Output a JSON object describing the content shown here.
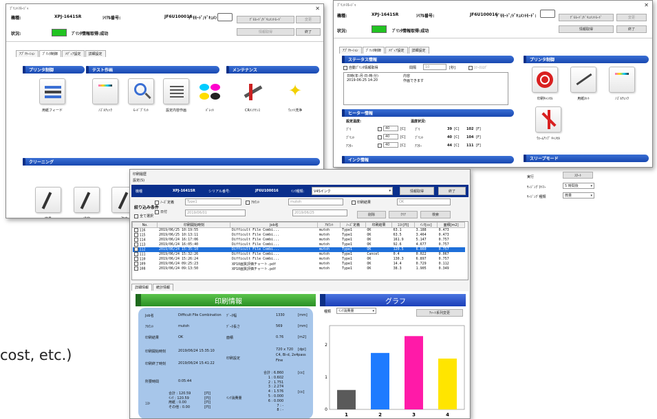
{
  "left_window": {
    "title": "ﾌﾟﾘﾝﾄﾏﾈｰｼﾞｬ",
    "model_label": "機種:",
    "model": "XPJ-1641SR",
    "serial_label": "ｼﾘｱﾙ番号:",
    "serial": "JF6U100016",
    "demo_label": "ﾃﾞﾓﾓｰﾄﾞ/ﾄﾞｷｭﾒﾝﾄﾓｰﾄﾞ:",
    "demo_btn": "ﾃﾞﾓﾓｰﾄﾞ/ﾄﾞｷｭﾒﾝﾄﾓｰﾄﾞ",
    "change_btn": "変更",
    "status_label": "状況:",
    "status_text": "ﾌﾟﾘﾝﾀ情報取得:成功",
    "info_btn": "情報取得",
    "end_btn": "終了",
    "tabs": [
      "ｱﾌﾟﾘｹｰｼｮﾝ",
      "ﾌﾟﾘﾝﾀ制御",
      "ﾒﾃﾞｨｱ設定",
      "詳細設定"
    ],
    "sec_printer": "プリンタ制御",
    "sec_test": "テスト作画",
    "sec_maint": "メンテナンス",
    "sec_clean": "クリーニング",
    "icons": [
      "用紙フィード",
      "ﾉｽﾞﾙﾁｪｯｸ",
      "ﾓｰﾄﾞﾌﾟﾘﾝﾄ",
      "設定内容作画",
      "ﾊﾟﾚｯﾄ",
      "CRﾒﾝﾃﾅﾝｽ",
      "ｳｪｯﾄ洗浄"
    ],
    "clean_icons": [
      "微量",
      "通常",
      "強力"
    ]
  },
  "right_window": {
    "title": "ﾌﾟﾘﾝﾄﾏﾈｰｼﾞｬ",
    "model_label": "機種:",
    "model": "XPJ-1641SR",
    "serial_label": "ｼﾘｱﾙ番号:",
    "serial": "JF6U100016",
    "demo_label": "ﾃﾞﾓﾓｰﾄﾞ/ﾄﾞｷｭﾒﾝﾄﾓｰﾄﾞ:",
    "demo_btn": "ﾃﾞﾓﾓｰﾄﾞ/ﾄﾞｷｭﾒﾝﾄﾓｰﾄﾞ",
    "change_btn": "変更",
    "status_label": "状況:",
    "status_text": "ﾌﾟﾘﾝﾀ情報取得:成功",
    "info_btn": "情報取得",
    "end_btn": "終了",
    "tabs": [
      "ｱﾌﾟﾘｹｰｼｮﾝ",
      "ﾌﾟﾘﾝﾀ制御",
      "ﾒﾃﾞｨｱ設定",
      "詳細設定"
    ],
    "sec_status": "ステータス情報",
    "auto_label": "自動ﾌﾟﾘﾝﾀ情報取得",
    "interval_label": "間隔",
    "interval_value": "10",
    "interval_unit": "[秒]",
    "status_log_label": "ｽﾃｰﾀｽﾛｸﾞ",
    "log_head_date": "日時(年-月-日-時:分)",
    "log_head_content": "内容",
    "log_date": "2019-06-25 14:20",
    "log_content": "作画できます",
    "sec_heater": "ヒーター情報",
    "set_temp": "設定温度:",
    "temp_status": "温度状況:",
    "heaters": [
      {
        "name": "ﾌﾟﾘ",
        "set": "40",
        "cur": "39",
        "f": "102"
      },
      {
        "name": "ﾌﾟﾘﾝﾄ",
        "set": "40",
        "cur": "40",
        "f": "104"
      },
      {
        "name": "ｱﾌﾀｰ",
        "set": "40",
        "cur": "44",
        "f": "111"
      }
    ],
    "unit_c": "[C]",
    "unit_f": "[F]",
    "sec_ink": "インク情報",
    "sec_printctl": "プリンタ制御",
    "ctl_icons": [
      "印刷ｷｬﾝｾﾙ",
      "用紙ｶｯﾄ",
      "ﾉｽﾞﾙﾁｪｯｸ",
      "ｳｫｰﾑｱｯﾌﾟ ｷｬﾝｾﾙ"
    ],
    "sec_sleep": "スリープモード",
    "exec_label": "実行",
    "start_btn": "ｽﾀｰﾄ",
    "timer_label": "ｻｰｼﾞﾝｸﾞﾀｲﾏｰ",
    "timer_value": "5 時間後",
    "kind_label": "ｻｰｼﾞﾝｸﾞ種類",
    "kind_value": "微量"
  },
  "front_window": {
    "title": "印刷履歴",
    "menu": "設定(S)",
    "model_label": "機種",
    "model": "XPJ-1641SR",
    "serial_label": "シリアル番号:",
    "serial": "JF6U100016",
    "ink_label": "ｲﾝｸ種類:",
    "ink_value": "V4Sインク",
    "info_btn": "情報取得",
    "end_btn": "終了",
    "filter_label": "絞り込み条件",
    "nozzle_cb": "ﾉｰｽﾞ定義",
    "type_value": "Type1",
    "account_cb": "ｱｶｳﾝﾄ",
    "account_value": "mutoh",
    "result_cb": "印刷結果",
    "result_value": "OK",
    "all_cb": "全て選択",
    "date_cb": "日付",
    "date_from": "2019/06/01",
    "date_to": "2019/06/25",
    "delete_btn": "削除",
    "clear_btn": "ｸﾘｱ",
    "search_btn": "検索",
    "columns": [
      "No.",
      "印刷開始時刻",
      "Job名",
      "ｱｶｳﾝﾄ",
      "ﾉｰｽﾞ定義",
      "印刷結果",
      "ｺｽﾄ[円]",
      "ｲﾝｸ[cc]",
      "面積[m2]"
    ],
    "rows": [
      [
        "116",
        "2019/06/25 10:19:55",
        "Difficult File Combi...",
        "mutoh",
        "Type1",
        "OK",
        "63.1",
        "3.188",
        "0.473"
      ],
      [
        "115",
        "2019/06/25 10:13:11",
        "Difficult File Combi...",
        "mutoh",
        "Type1",
        "OK",
        "63.5",
        "3.464",
        "0.473"
      ],
      [
        "114",
        "2019/06/24 16:17:06",
        "Difficult File Combi...",
        "mutoh",
        "Type1",
        "OK",
        "161.9",
        "5.147",
        "0.757"
      ],
      [
        "113",
        "2019/06/24 16:05:40",
        "Difficult File Combi...",
        "mutoh",
        "Type1",
        "OK",
        "92.6",
        "4.677",
        "0.757"
      ],
      [
        "112",
        "2019/06/24 15:35:10",
        "Difficult File Combi...",
        "mutoh",
        "Type1",
        "OK",
        "120.5",
        "6.860",
        "0.757"
      ],
      [
        "111",
        "2019/06/24 15:32:26",
        "Difficult File Combi...",
        "mutoh",
        "Type1",
        "Cancel",
        "0.4",
        "0.022",
        "0.067"
      ],
      [
        "110",
        "2019/06/24 15:26:24",
        "Difficult File Combi...",
        "mutoh",
        "Type1",
        "OK",
        "130.3",
        "6.897",
        "0.757"
      ],
      [
        "109",
        "2019/06/24 09:25:23",
        "XP10画質評価チャート.pdf",
        "mutoh",
        "Type1",
        "OK",
        "14.4",
        "0.729",
        "0.112"
      ],
      [
        "108",
        "2019/06/24 09:13:50",
        "XP10画質評価チャート.pdf",
        "mutoh",
        "Type1",
        "OK",
        "38.3",
        "1.905",
        "0.349"
      ]
    ],
    "tabs": [
      "詳細情報",
      "統計情報"
    ],
    "banner_info": "印刷情報",
    "banner_graph": "グラフ",
    "info": {
      "job_k": "Job名",
      "job_v": "Difficult File Combination",
      "acct_k": "ｱｶｳﾝﾄ",
      "acct_v": "mutoh",
      "res_k": "印刷結果",
      "res_v": "OK",
      "start_k": "印刷開始時刻",
      "start_v": "2019/06/24 15:35:10",
      "end_k": "印刷終了時刻",
      "end_v": "2019/06/24 15:41:22",
      "time_k": "所要時間",
      "time_v": "0:05:44",
      "cost_k": "ｺｽﾄ",
      "cost_lines": [
        "合計 : 120.59",
        "ｲﾝｸ : 120.59",
        "用紙 : 0.00",
        "その他 : 0.00"
      ],
      "yen": "[円]",
      "dw_k": "ﾃﾞｰﾀ幅",
      "dw_v": "1330",
      "dw_u": "[mm]",
      "dl_k": "ﾃﾞｰﾀ長さ",
      "dl_v": "569",
      "dl_u": "[mm]",
      "area_k": "面積",
      "area_v": "0.76",
      "area_u": "[m2]",
      "ps_k": "印刷設定",
      "ps_v1": "720 x 720",
      "ps_u": "[dpi]",
      "ps_v2": "C4, Bi-d, 2x4pass",
      "ps_v3": "Fine",
      "ink_k": "ｲﾝｸ消費量",
      "ink_lines": [
        "合計 : 6.860",
        "1 : 0.602",
        "2 : 1.751",
        "3 : 2.274",
        "4 : 1.576",
        "5 : 0.000",
        "6 : 0.000",
        "7 : -",
        "8 : -"
      ],
      "cc": "[cc]"
    },
    "graph_kind_label": "種類",
    "graph_kind_value": "ｲﾝｸ消費量",
    "series_btn": "ﾁｬｰﾄ系列変更"
  },
  "chart_data": {
    "type": "bar",
    "categories": [
      "1",
      "2",
      "3",
      "4"
    ],
    "values": [
      0.602,
      1.751,
      2.274,
      1.576
    ],
    "ylim": [
      0,
      2.6
    ],
    "yticks": [
      "0",
      "1",
      "2"
    ],
    "colors": [
      "#5a5a5a",
      "#1e7bff",
      "#ff1aa8",
      "#ffe500"
    ]
  },
  "caption_fragment": "cost, etc.)"
}
